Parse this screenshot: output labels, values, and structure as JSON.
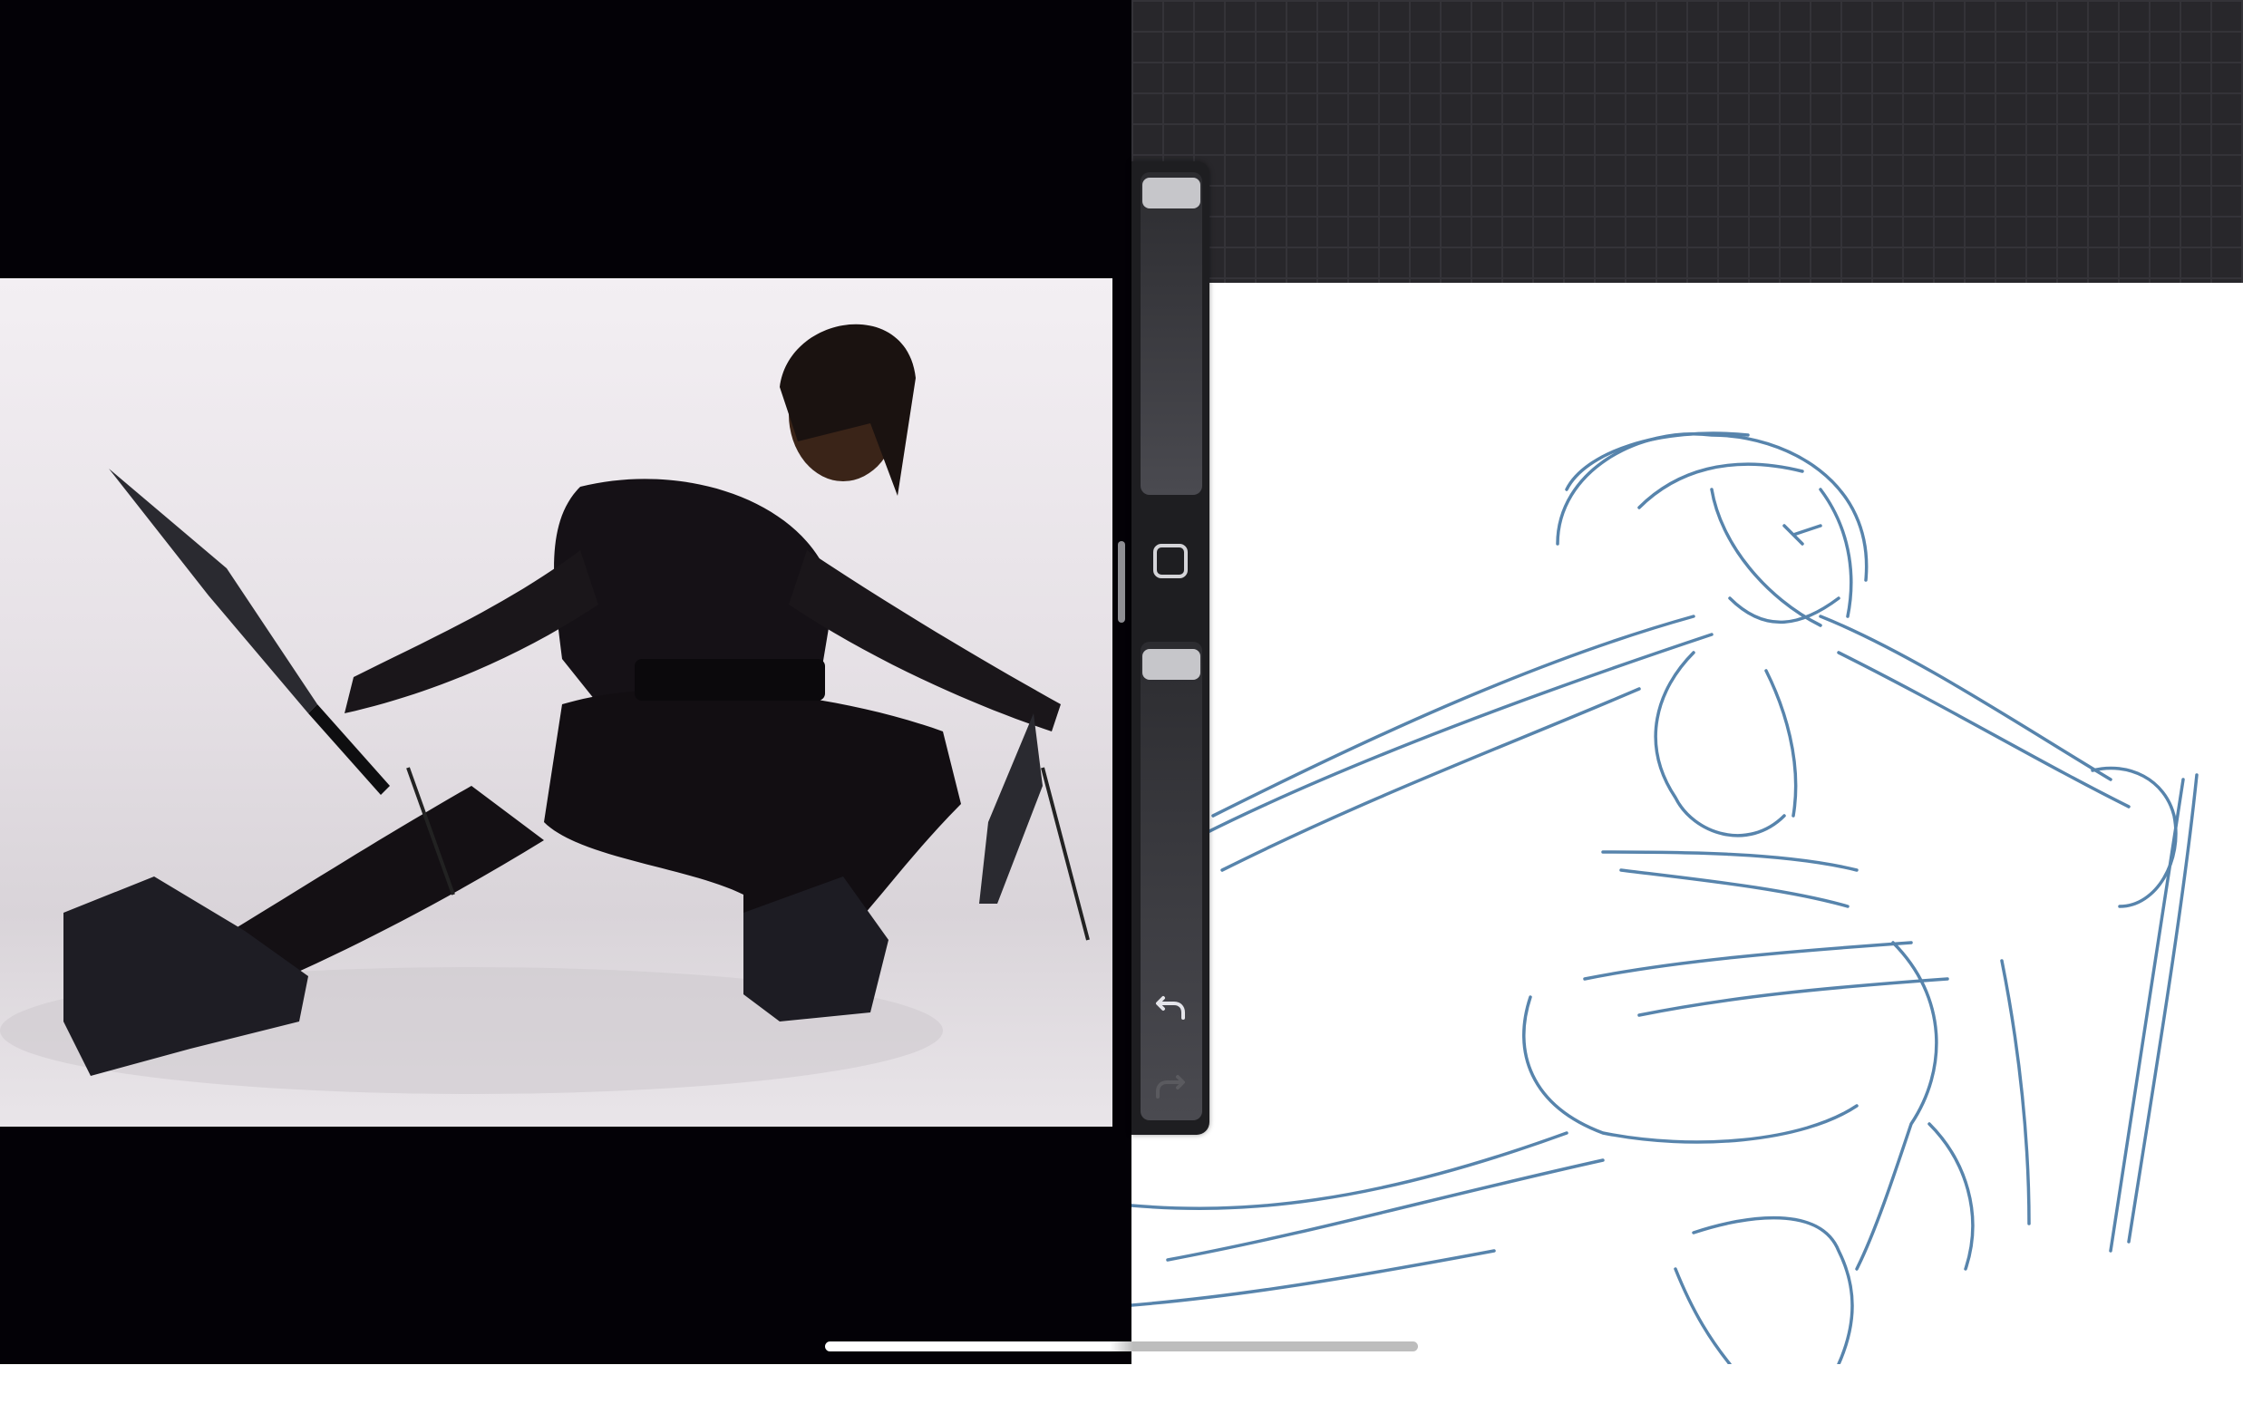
{
  "reference_panel": {
    "image_name": "reference-photo",
    "subject": "pose-reference"
  },
  "canvas": {
    "background_color": "#ffffff",
    "grid_color": "#28272b",
    "sketch_color": "#3a6f9e"
  },
  "sidebar": {
    "size_slider_value": 1.0,
    "opacity_slider_value": 1.0,
    "modify_button_icon": "square-icon",
    "undo_icon": "undo-icon",
    "redo_icon": "redo-icon",
    "redo_enabled": false
  },
  "system": {
    "home_indicator": "home-indicator"
  }
}
